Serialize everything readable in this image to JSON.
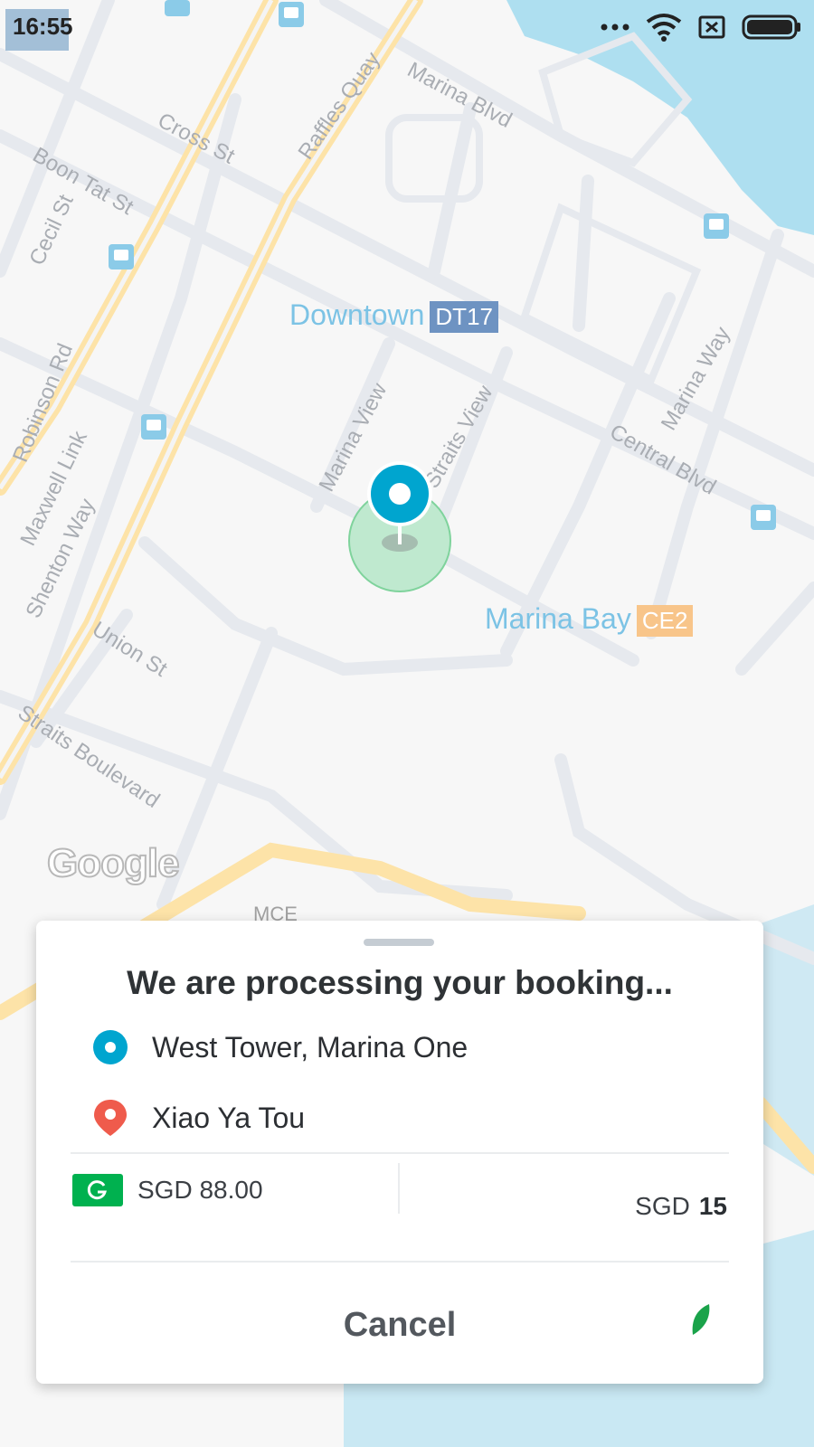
{
  "status_bar": {
    "time": "16:55",
    "icons": [
      "more-dots-icon",
      "wifi-icon",
      "sim-off-icon",
      "battery-icon"
    ]
  },
  "map": {
    "streets": [
      "Marina Blvd",
      "Cross St",
      "Raffles Quay",
      "Boon Tat St",
      "Cecil St",
      "Robinson Rd",
      "Maxwell Link",
      "Shenton Way",
      "Marina View",
      "Straits View",
      "Central Blvd",
      "Marina Way",
      "Union St",
      "Straits Boulevard",
      "MCE"
    ],
    "places": [
      {
        "name": "Downtown",
        "code": "DT17",
        "code_color": "#6e93c2"
      },
      {
        "name": "Marina Bay",
        "code": "CE2",
        "code_color": "#f8c58a"
      }
    ],
    "attribution": "Google",
    "pin_icon": "pickup-location-pin-icon",
    "colors": {
      "water": "#aedff0",
      "road_major": "#fde8b5",
      "road_minor": "#e4e8ed"
    }
  },
  "booking": {
    "title": "We are processing your booking...",
    "pickup": "West Tower, Marina One",
    "dropoff": "Xiao Ya Tou",
    "payment": {
      "icon": "grabpay-wallet-icon",
      "label": "SGD 88.00",
      "brand_color": "#00b14f"
    },
    "fare": {
      "currency": "SGD",
      "amount": "15"
    },
    "cancel_label": "Cancel",
    "pickup_color": "#00a5cf",
    "dropoff_color": "#ef5b4c"
  }
}
